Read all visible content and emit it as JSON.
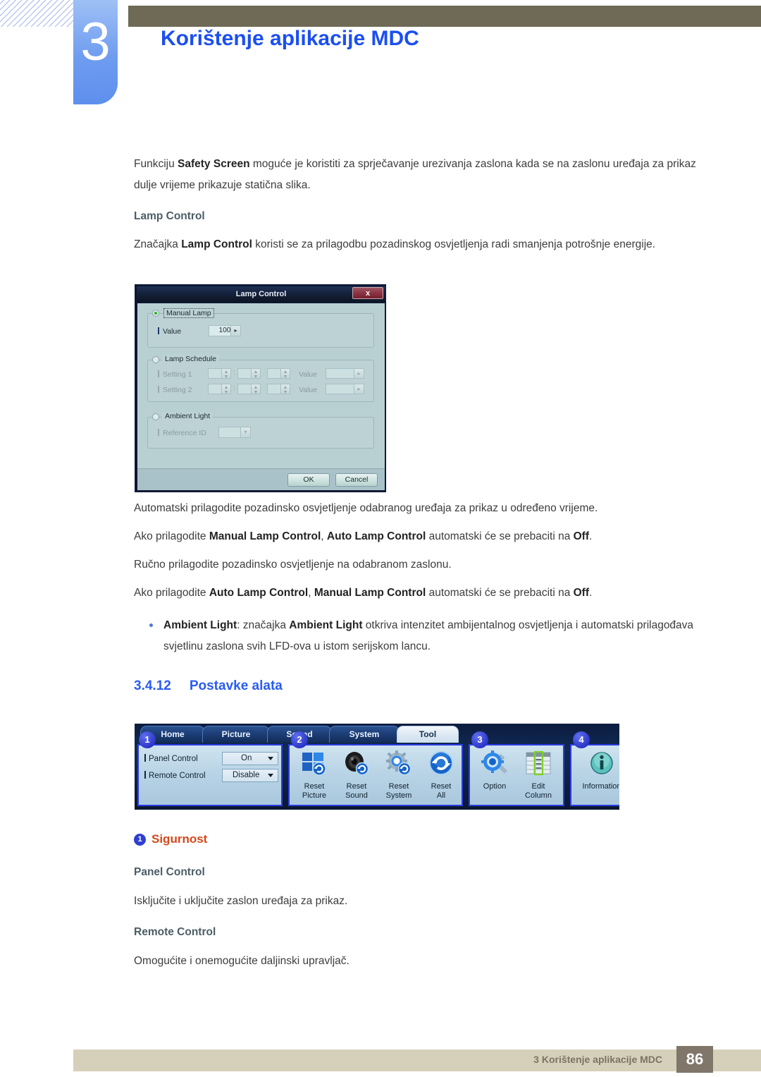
{
  "header": {
    "chapter_number": "3",
    "title": "Korištenje aplikacije MDC"
  },
  "body": {
    "intro_p1_pre": "Funkciju ",
    "intro_p1_bold": "Safety Screen",
    "intro_p1_post": " moguće je koristiti za sprječavanje urezivanja zaslona kada se na zaslonu uređaja za prikaz dulje vrijeme prikazuje statična slika.",
    "lamp_control_heading": "Lamp Control",
    "lamp_p_pre": "Značajka ",
    "lamp_p_bold": "Lamp Control",
    "lamp_p_post": " koristi se za prilagodbu pozadinskog osvjetljenja radi smanjenja potrošnje energije.",
    "para_auto": "Automatski prilagodite pozadinsko osvjetljenje odabranog uređaja za prikaz u određeno vrijeme.",
    "para_manual_pre": "Ako prilagodite ",
    "para_manual_b1": "Manual Lamp Control",
    "para_manual_mid": ", ",
    "para_manual_b2": "Auto Lamp Control",
    "para_manual_post": " automatski će se prebaciti na ",
    "para_manual_b3": "Off",
    "para_manual_end": ".",
    "para_rucno": "Ručno prilagodite pozadinsko osvjetljenje na odabranom zaslonu.",
    "para_auto2_pre": "Ako prilagodite ",
    "para_auto2_b1": "Auto Lamp Control",
    "para_auto2_mid": ", ",
    "para_auto2_b2": "Manual Lamp Control",
    "para_auto2_post": " automatski će se prebaciti na ",
    "para_auto2_b3": "Off",
    "para_auto2_end": ".",
    "bullet_b1": "Ambient Light",
    "bullet_mid": ": značajka ",
    "bullet_b2": "Ambient Light",
    "bullet_post": " otkriva intenzitet ambijentalnog osvjetljenja i automatski prilagođava svjetlinu zaslona svih LFD-ova u istom serijskom lancu."
  },
  "section": {
    "number": "3.4.12",
    "title": "Postavke alata"
  },
  "security": {
    "badge": "1",
    "label": "Sigurnost",
    "panel_control_heading": "Panel Control",
    "panel_control_text": "Isključite i uključite zaslon uređaja za prikaz.",
    "remote_control_heading": "Remote Control",
    "remote_control_text": "Omogućite i onemogućite daljinski upravljač."
  },
  "dialog": {
    "title": "Lamp Control",
    "close_label": "x",
    "manual_lamp": {
      "group_label": "Manual Lamp",
      "value_label": "Value",
      "value": "100",
      "arrow": "▸"
    },
    "lamp_schedule": {
      "group_label": "Lamp Schedule",
      "setting1_label": "Setting 1",
      "setting2_label": "Setting 2",
      "value_label": "Value",
      "colon": ":",
      "arrow": "▸",
      "spin_up": "▲",
      "spin_down": "▼"
    },
    "ambient_light": {
      "group_label": "Ambient Light",
      "reference_id_label": "Reference ID",
      "caret": "▾"
    },
    "ok_label": "OK",
    "cancel_label": "Cancel"
  },
  "toolbar": {
    "tabs": [
      {
        "label": "Home",
        "active": false
      },
      {
        "label": "Picture",
        "active": false
      },
      {
        "label": "Sound",
        "active": false
      },
      {
        "label": "System",
        "active": false
      },
      {
        "label": "Tool",
        "active": true
      }
    ],
    "group1": {
      "badge": "1",
      "panel_control_label": "Panel Control",
      "panel_control_value": "On",
      "remote_control_label": "Remote Control",
      "remote_control_value": "Disable"
    },
    "group2": {
      "badge": "2",
      "items": [
        {
          "caption_line1": "Reset",
          "caption_line2": "Picture",
          "icon": "reset-picture-icon"
        },
        {
          "caption_line1": "Reset",
          "caption_line2": "Sound",
          "icon": "reset-sound-icon"
        },
        {
          "caption_line1": "Reset",
          "caption_line2": "System",
          "icon": "reset-system-icon"
        },
        {
          "caption_line1": "Reset",
          "caption_line2": "All",
          "icon": "reset-all-icon"
        }
      ]
    },
    "group3": {
      "badge": "3",
      "items": [
        {
          "caption_line1": "Option",
          "caption_line2": "",
          "icon": "option-gear-wrench-icon"
        },
        {
          "caption_line1": "Edit",
          "caption_line2": "Column",
          "icon": "edit-column-icon"
        }
      ]
    },
    "group4": {
      "badge": "4",
      "items": [
        {
          "caption_line1": "Information",
          "caption_line2": "",
          "icon": "information-icon"
        }
      ]
    }
  },
  "footer": {
    "text": "3 Korištenje aplikacije MDC",
    "page_number": "86"
  },
  "colors": {
    "accent_blue": "#1b4ff0",
    "heading_blue": "#2a5cf0",
    "orange": "#d4491c",
    "header_bar": "#6e6a56",
    "footer_band": "#d6d0ba",
    "footer_page_box": "#80766a"
  }
}
